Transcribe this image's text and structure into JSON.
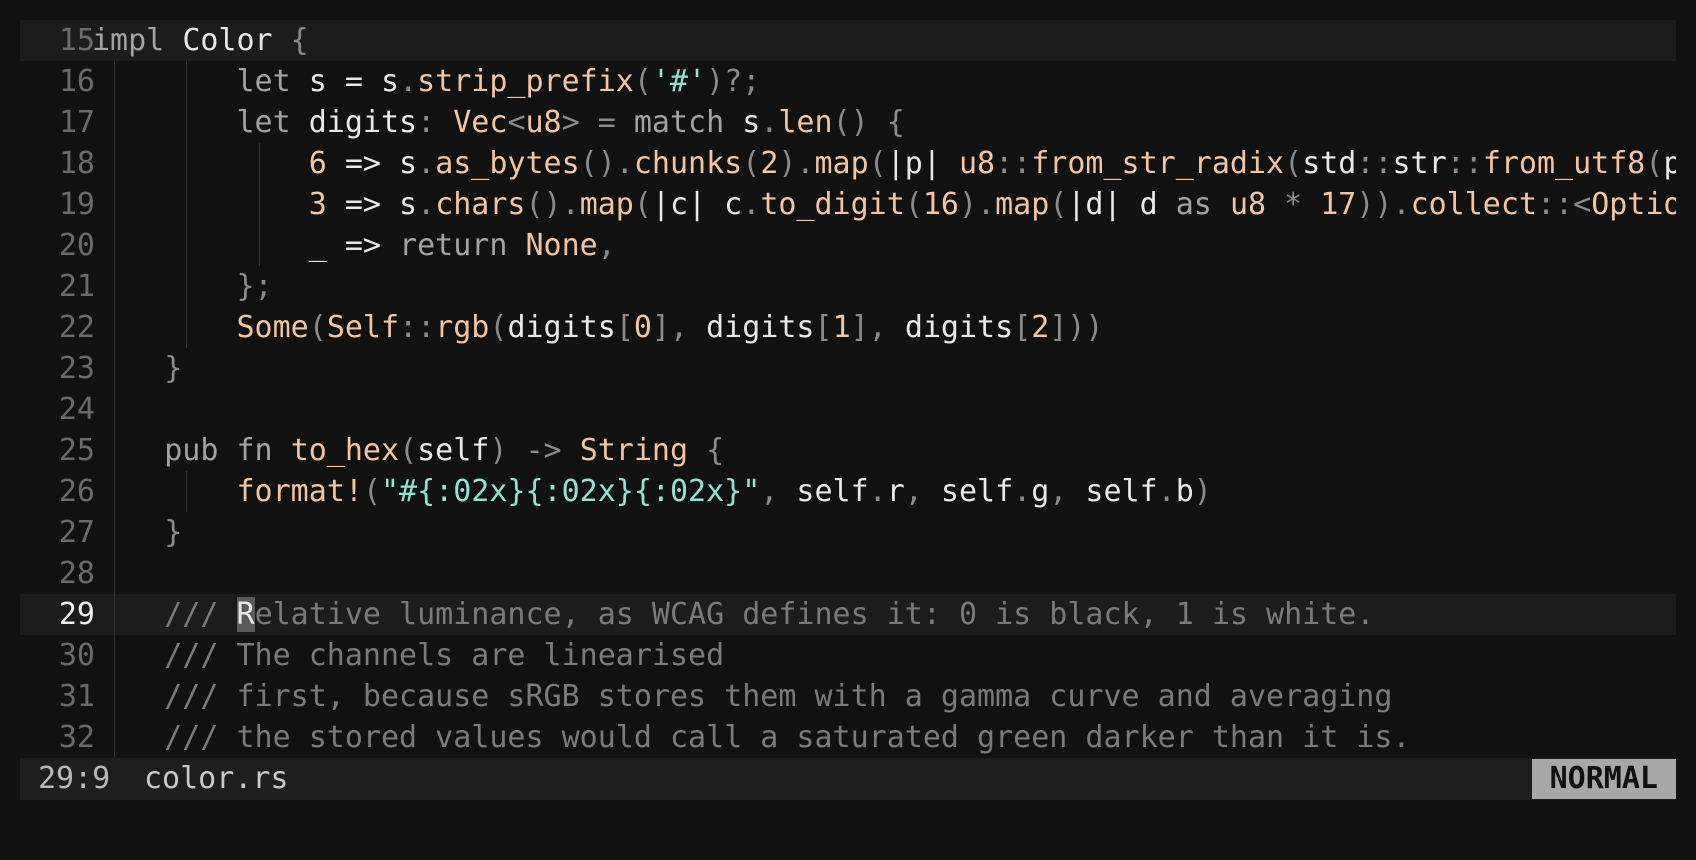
{
  "editor": {
    "lines": [
      {
        "number": "15",
        "indent": 0,
        "guides": 0,
        "highlight": true,
        "active": false,
        "tokens": [
          [
            "impl",
            "kw"
          ],
          [
            " ",
            "id"
          ],
          [
            "Color",
            "id"
          ],
          [
            " {",
            "pu"
          ]
        ]
      },
      {
        "number": "16",
        "indent": 8,
        "guides": 2,
        "highlight": false,
        "active": false,
        "tokens": [
          [
            "let",
            "kw"
          ],
          [
            " s = s",
            "id"
          ],
          [
            ".",
            "pu"
          ],
          [
            "strip_prefix",
            "fn"
          ],
          [
            "(",
            "pu"
          ],
          [
            "'#'",
            "str"
          ],
          [
            ")?;",
            "pu"
          ]
        ]
      },
      {
        "number": "17",
        "indent": 8,
        "guides": 2,
        "highlight": false,
        "active": false,
        "tokens": [
          [
            "let",
            "kw"
          ],
          [
            " digits",
            "id"
          ],
          [
            ": ",
            "pu"
          ],
          [
            "Vec",
            "ty"
          ],
          [
            "<",
            "pu"
          ],
          [
            "u8",
            "ty"
          ],
          [
            "> = ",
            "pu"
          ],
          [
            "match",
            "kw"
          ],
          [
            " s",
            "id"
          ],
          [
            ".",
            "pu"
          ],
          [
            "len",
            "fn"
          ],
          [
            "() {",
            "pu"
          ]
        ]
      },
      {
        "number": "18",
        "indent": 12,
        "guides": 3,
        "highlight": false,
        "active": false,
        "tokens": [
          [
            "6",
            "num"
          ],
          [
            " => s",
            "id"
          ],
          [
            ".",
            "pu"
          ],
          [
            "as_bytes",
            "fn"
          ],
          [
            "().",
            "pu"
          ],
          [
            "chunks",
            "fn"
          ],
          [
            "(",
            "pu"
          ],
          [
            "2",
            "num"
          ],
          [
            ").",
            "pu"
          ],
          [
            "map",
            "fn"
          ],
          [
            "(",
            "pu"
          ],
          [
            "|p| ",
            "id"
          ],
          [
            "u8",
            "ty"
          ],
          [
            "::",
            "pu"
          ],
          [
            "from_str_radix",
            "fn"
          ],
          [
            "(",
            "pu"
          ],
          [
            "std",
            "id"
          ],
          [
            "::",
            "pu"
          ],
          [
            "str",
            "id"
          ],
          [
            "::",
            "pu"
          ],
          [
            "from_utf8",
            "fn"
          ],
          [
            "(",
            "pu"
          ],
          [
            "p",
            "id"
          ]
        ]
      },
      {
        "number": "19",
        "indent": 12,
        "guides": 3,
        "highlight": false,
        "active": false,
        "tokens": [
          [
            "3",
            "num"
          ],
          [
            " => s",
            "id"
          ],
          [
            ".",
            "pu"
          ],
          [
            "chars",
            "fn"
          ],
          [
            "().",
            "pu"
          ],
          [
            "map",
            "fn"
          ],
          [
            "(",
            "pu"
          ],
          [
            "|c| c",
            "id"
          ],
          [
            ".",
            "pu"
          ],
          [
            "to_digit",
            "fn"
          ],
          [
            "(",
            "pu"
          ],
          [
            "16",
            "num"
          ],
          [
            ").",
            "pu"
          ],
          [
            "map",
            "fn"
          ],
          [
            "(",
            "pu"
          ],
          [
            "|d| d ",
            "id"
          ],
          [
            "as",
            "kw"
          ],
          [
            " ",
            "id"
          ],
          [
            "u8",
            "ty"
          ],
          [
            " * ",
            "pu"
          ],
          [
            "17",
            "num"
          ],
          [
            ")).",
            "pu"
          ],
          [
            "collect",
            "fn"
          ],
          [
            "::<",
            "pu"
          ],
          [
            "Optio",
            "ty"
          ]
        ]
      },
      {
        "number": "20",
        "indent": 12,
        "guides": 3,
        "highlight": false,
        "active": false,
        "tokens": [
          [
            "_ => ",
            "id"
          ],
          [
            "return",
            "kw"
          ],
          [
            " ",
            "id"
          ],
          [
            "None",
            "ty"
          ],
          [
            ",",
            "pu"
          ]
        ]
      },
      {
        "number": "21",
        "indent": 8,
        "guides": 2,
        "highlight": false,
        "active": false,
        "tokens": [
          [
            "};",
            "pu"
          ]
        ]
      },
      {
        "number": "22",
        "indent": 8,
        "guides": 2,
        "highlight": false,
        "active": false,
        "tokens": [
          [
            "Some",
            "ty"
          ],
          [
            "(",
            "pu"
          ],
          [
            "Self",
            "ty"
          ],
          [
            "::",
            "pu"
          ],
          [
            "rgb",
            "fn"
          ],
          [
            "(",
            "pu"
          ],
          [
            "digits",
            "id"
          ],
          [
            "[",
            "pu"
          ],
          [
            "0",
            "num"
          ],
          [
            "], ",
            "pu"
          ],
          [
            "digits",
            "id"
          ],
          [
            "[",
            "pu"
          ],
          [
            "1",
            "num"
          ],
          [
            "], ",
            "pu"
          ],
          [
            "digits",
            "id"
          ],
          [
            "[",
            "pu"
          ],
          [
            "2",
            "num"
          ],
          [
            "]))",
            "pu"
          ]
        ]
      },
      {
        "number": "23",
        "indent": 4,
        "guides": 1,
        "highlight": false,
        "active": false,
        "tokens": [
          [
            "}",
            "pu"
          ]
        ]
      },
      {
        "number": "24",
        "indent": 0,
        "guides": 1,
        "highlight": false,
        "active": false,
        "tokens": []
      },
      {
        "number": "25",
        "indent": 4,
        "guides": 1,
        "highlight": false,
        "active": false,
        "tokens": [
          [
            "pub",
            "kw"
          ],
          [
            " ",
            "id"
          ],
          [
            "fn",
            "kw"
          ],
          [
            " ",
            "id"
          ],
          [
            "to_hex",
            "fn"
          ],
          [
            "(",
            "pu"
          ],
          [
            "self",
            "id"
          ],
          [
            ") -> ",
            "pu"
          ],
          [
            "String",
            "ty"
          ],
          [
            " {",
            "pu"
          ]
        ]
      },
      {
        "number": "26",
        "indent": 8,
        "guides": 2,
        "highlight": false,
        "active": false,
        "tokens": [
          [
            "format!",
            "fn"
          ],
          [
            "(",
            "pu"
          ],
          [
            "\"#{:02x}{:02x}{:02x}\"",
            "str"
          ],
          [
            ", ",
            "pu"
          ],
          [
            "self",
            "id"
          ],
          [
            ".",
            "pu"
          ],
          [
            "r",
            "id"
          ],
          [
            ", ",
            "pu"
          ],
          [
            "self",
            "id"
          ],
          [
            ".",
            "pu"
          ],
          [
            "g",
            "id"
          ],
          [
            ", ",
            "pu"
          ],
          [
            "self",
            "id"
          ],
          [
            ".",
            "pu"
          ],
          [
            "b",
            "id"
          ],
          [
            ")",
            "pu"
          ]
        ]
      },
      {
        "number": "27",
        "indent": 4,
        "guides": 1,
        "highlight": false,
        "active": false,
        "tokens": [
          [
            "}",
            "pu"
          ]
        ]
      },
      {
        "number": "28",
        "indent": 0,
        "guides": 1,
        "highlight": false,
        "active": false,
        "tokens": []
      },
      {
        "number": "29",
        "indent": 4,
        "guides": 1,
        "highlight": true,
        "active": true,
        "tokens": [
          [
            "/// ",
            "cm"
          ],
          [
            "R",
            "cur"
          ],
          [
            "elative luminance, as WCAG defines it: 0 is black, 1 is white.",
            "cm"
          ]
        ]
      },
      {
        "number": "30",
        "indent": 4,
        "guides": 1,
        "highlight": false,
        "active": false,
        "tokens": [
          [
            "/// The channels are linearised",
            "cm"
          ]
        ]
      },
      {
        "number": "31",
        "indent": 4,
        "guides": 1,
        "highlight": false,
        "active": false,
        "tokens": [
          [
            "/// first, because sRGB stores them with a gamma curve and averaging",
            "cm"
          ]
        ]
      },
      {
        "number": "32",
        "indent": 4,
        "guides": 1,
        "highlight": false,
        "active": false,
        "tokens": [
          [
            "/// the stored values would call a saturated green darker than it is.",
            "cm"
          ]
        ]
      }
    ]
  },
  "statusbar": {
    "position": "29:9",
    "filename": "color.rs",
    "mode": "NORMAL"
  },
  "colors": {
    "background": "#111111",
    "current_line": "#1c1c1c",
    "function": "#f4c4a0",
    "string": "#8fe3cf",
    "comment": "#7a7a7a",
    "mode_badge": "#a8a8a8"
  }
}
